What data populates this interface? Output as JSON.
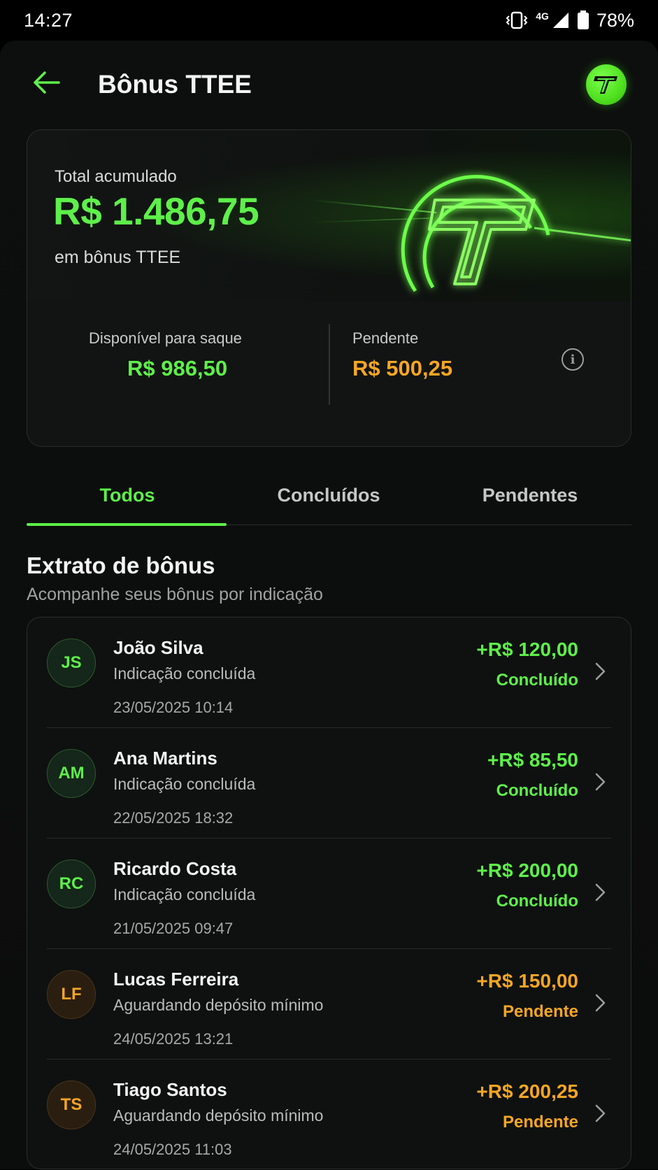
{
  "status": {
    "time": "14:27",
    "network": "4G",
    "battery": "78%"
  },
  "header": {
    "title": "Bônus TTEE",
    "logo_letter": "T"
  },
  "summary": {
    "total_label": "Total acumulado",
    "total_value": "R$ 1.486,75",
    "total_sub": "em bônus TTEE",
    "available_label": "Disponível para saque",
    "available_value": "R$ 986,50",
    "pending_label": "Pendente",
    "pending_value": "R$ 500,25",
    "info_glyph": "i"
  },
  "tabs": [
    {
      "label": "Todos",
      "active": true
    },
    {
      "label": "Concluídos",
      "active": false
    },
    {
      "label": "Pendentes",
      "active": false
    }
  ],
  "section": {
    "title": "Extrato de bônus",
    "subtitle": "Acompanhe seus bônus por indicação"
  },
  "items": [
    {
      "initials": "JS",
      "name": "João Silva",
      "desc": "Indicação concluída",
      "date": "23/05/2025 10:14",
      "amount": "+R$ 120,00",
      "status": "Concluído"
    },
    {
      "initials": "AM",
      "name": "Ana Martins",
      "desc": "Indicação concluída",
      "date": "22/05/2025 18:32",
      "amount": "+R$ 85,50",
      "status": "Concluído"
    },
    {
      "initials": "RC",
      "name": "Ricardo Costa",
      "desc": "Indicação concluída",
      "date": "21/05/2025 09:47",
      "amount": "+R$ 200,00",
      "status": "Concluído"
    },
    {
      "initials": "LF",
      "name": "Lucas Ferreira",
      "desc": "Aguardando depósito mínimo",
      "date": "24/05/2025 13:21",
      "amount": "+R$ 150,00",
      "status": "Pendente"
    },
    {
      "initials": "TS",
      "name": "Tiago Santos",
      "desc": "Aguardando depósito mínimo",
      "date": "24/05/2025 11:03",
      "amount": "+R$ 200,25",
      "status": "Pendente"
    }
  ],
  "colors": {
    "accent": "#5ef04a",
    "pending": "#f5a623",
    "background": "#0d0f0e"
  },
  "icons": {
    "back": "arrow-left-icon",
    "info": "info-icon",
    "chevron": "chevron-right-icon",
    "vibrate": "vibrate-icon",
    "signal": "signal-icon",
    "battery": "battery-icon"
  }
}
